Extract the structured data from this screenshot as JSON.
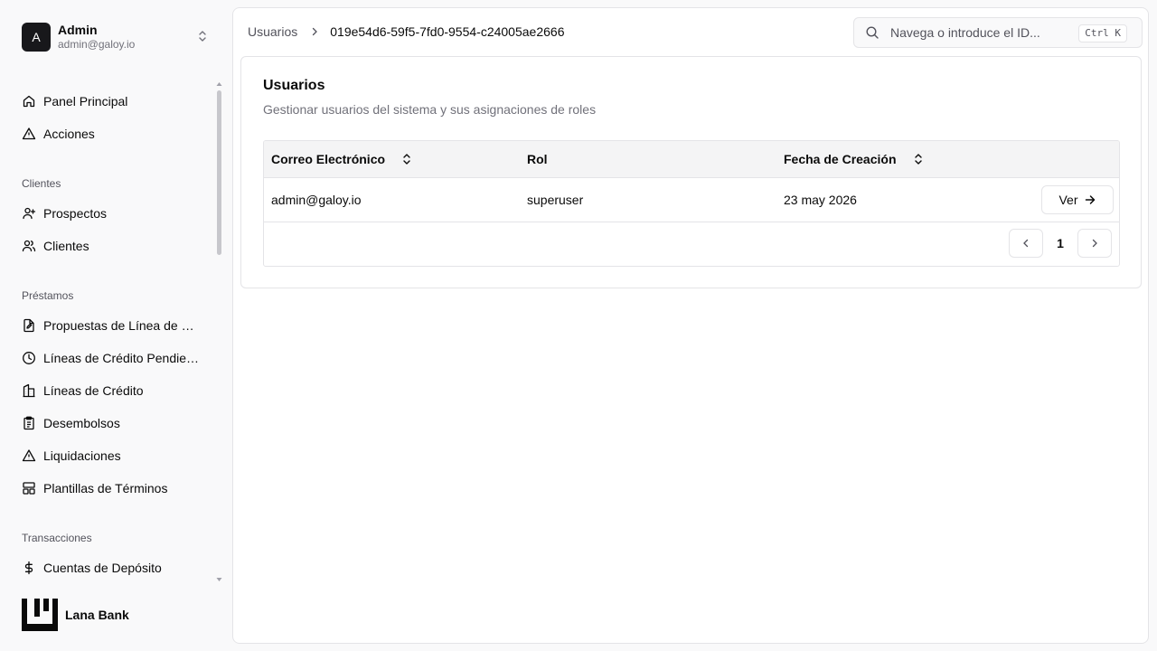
{
  "account": {
    "initial": "A",
    "name": "Admin",
    "email": "admin@galoy.io"
  },
  "nav": {
    "dashboard": "Panel Principal",
    "actions": "Acciones",
    "group_clients": "Clientes",
    "prospects": "Prospectos",
    "clients": "Clientes",
    "group_loans": "Préstamos",
    "proposals": "Propuestas de Línea de Crédito",
    "pending": "Líneas de Crédito Pendientes",
    "credit_lines": "Líneas de Crédito",
    "disbursals": "Desembolsos",
    "liquidations": "Liquidaciones",
    "term_templates": "Plantillas de Términos",
    "group_transactions": "Transacciones",
    "deposit_accounts": "Cuentas de Depósito"
  },
  "brand": {
    "name": "Lana Bank"
  },
  "breadcrumb": {
    "parent": "Usuarios",
    "current": "019e54d6-59f5-7fd0-9554-c24005ae2666"
  },
  "search": {
    "placeholder": "Navega o introduce el ID...",
    "shortcut": "Ctrl K"
  },
  "card": {
    "title": "Usuarios",
    "description": "Gestionar usuarios del sistema y sus asignaciones de roles"
  },
  "table": {
    "headers": {
      "email": "Correo Electrónico",
      "role": "Rol",
      "created": "Fecha de Creación"
    },
    "rows": [
      {
        "email": "admin@galoy.io",
        "role": "superuser",
        "created": "23 may 2026",
        "action": "Ver"
      }
    ]
  },
  "pagination": {
    "page": "1"
  },
  "colors": {
    "accent": "#18181b",
    "border": "#e4e4e7",
    "muted": "#71717a"
  }
}
